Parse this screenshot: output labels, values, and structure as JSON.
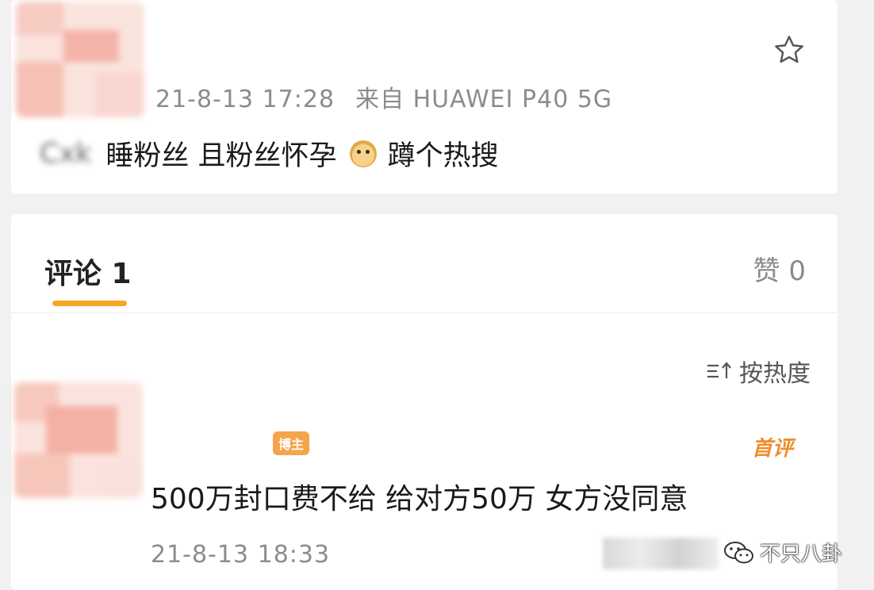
{
  "post": {
    "timestamp": "21-8-13 17:28",
    "source": "来自 HUAWEI P40 5G",
    "author_name": "Cxk",
    "text_part1": "睡粉丝 且粉丝怀孕",
    "emoji": "doge",
    "text_part2": "蹲个热搜",
    "star_icon": "star-outline-icon"
  },
  "comments_section": {
    "tab_label": "评论 1",
    "likes_label": "赞 0",
    "sort_label": "按热度",
    "accent_color": "#f5a623"
  },
  "comment": {
    "owner_badge": "博主",
    "first_badge": "首评",
    "text": "500万封口费不给 给对方50万 女方没同意",
    "timestamp": "21-8-13 18:33"
  },
  "watermark": {
    "text": "不只八卦",
    "icon": "wechat-icon"
  }
}
